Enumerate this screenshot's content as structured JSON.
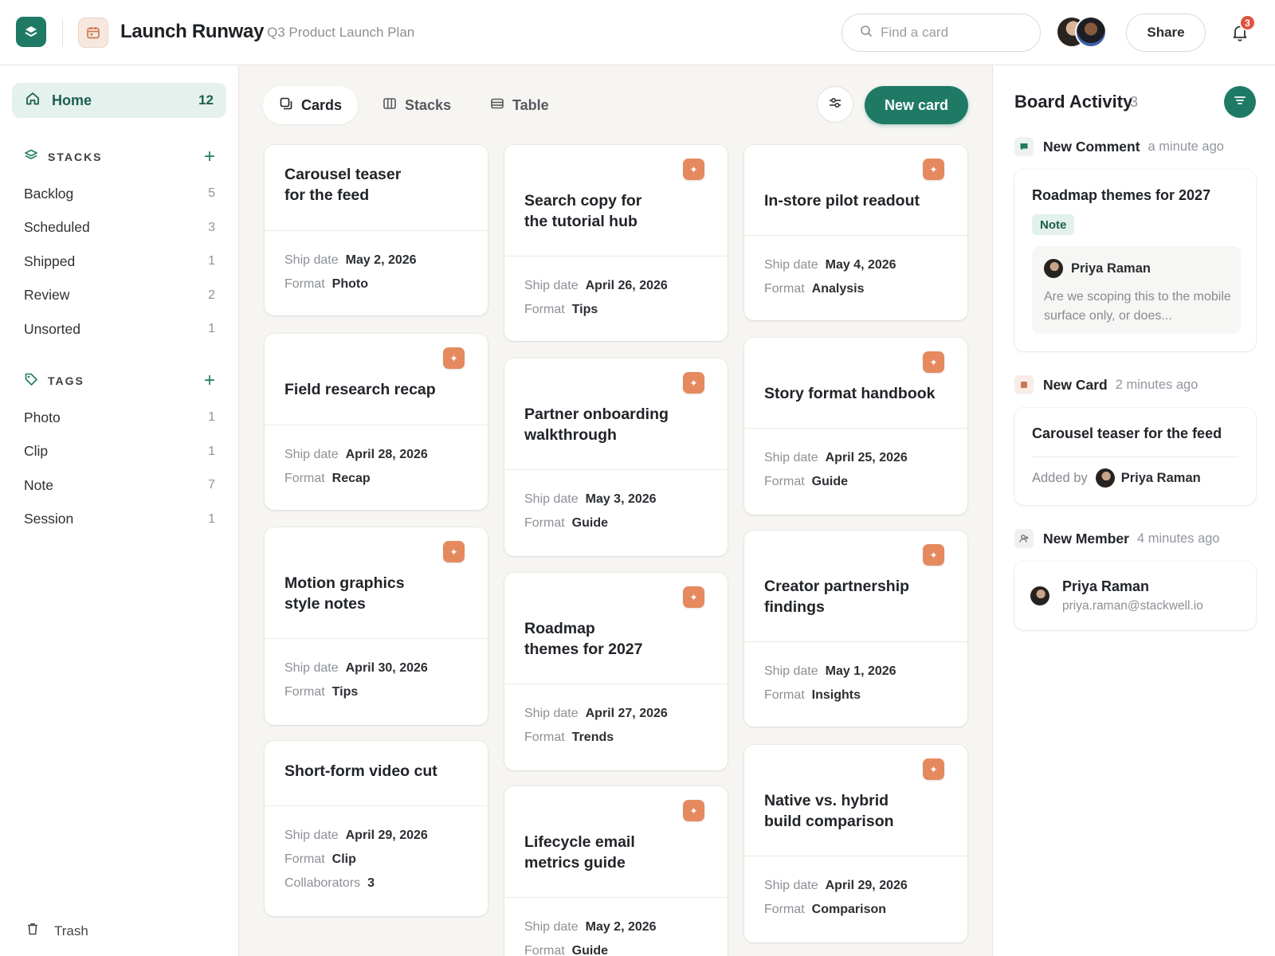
{
  "header": {
    "board_title": "Launch Runway",
    "board_subtitle": "Q3 Product Launch Plan",
    "search_placeholder": "Find a card",
    "share_label": "Share",
    "notification_count": "3"
  },
  "sidebar": {
    "home": {
      "label": "Home",
      "count": "12"
    },
    "stacks_title": "STACKS",
    "stacks": [
      {
        "label": "Backlog",
        "count": "5"
      },
      {
        "label": "Scheduled",
        "count": "3"
      },
      {
        "label": "Shipped",
        "count": "1"
      },
      {
        "label": "Review",
        "count": "2"
      },
      {
        "label": "Unsorted",
        "count": "1"
      }
    ],
    "tags_title": "TAGS",
    "tags": [
      {
        "label": "Photo",
        "count": "1"
      },
      {
        "label": "Clip",
        "count": "1"
      },
      {
        "label": "Note",
        "count": "7"
      },
      {
        "label": "Session",
        "count": "1"
      }
    ],
    "trash_label": "Trash"
  },
  "main": {
    "tabs": [
      {
        "label": "Cards",
        "active": true
      },
      {
        "label": "Stacks",
        "active": false
      },
      {
        "label": "Table",
        "active": false
      }
    ],
    "new_card_label": "New card",
    "meta_labels": {
      "ship_date": "Ship date",
      "format": "Format",
      "collaborators": "Collaborators"
    },
    "cards": [
      {
        "title_line1": "Carousel teaser",
        "title_line2": "for the feed",
        "ship_date": "May 2, 2026",
        "format": "Photo",
        "badge": false
      },
      {
        "title_line1": "Field research recap",
        "title_line2": "",
        "ship_date": "April 28, 2026",
        "format": "Recap",
        "badge": true
      },
      {
        "title_line1": "Motion graphics",
        "title_line2": "style notes",
        "ship_date": "April 30, 2026",
        "format": "Tips",
        "badge": true
      },
      {
        "title_line1": "Short-form video cut",
        "title_line2": "",
        "ship_date": "April 29, 2026",
        "format": "Clip",
        "collaborators": "3",
        "badge": false
      },
      {
        "title_line1": "Search copy for",
        "title_line2": "the tutorial hub",
        "ship_date": "April 26, 2026",
        "format": "Tips",
        "badge": true
      },
      {
        "title_line1": "Partner onboarding",
        "title_line2": "walkthrough",
        "ship_date": "May 3, 2026",
        "format": "Guide",
        "badge": true
      },
      {
        "title_line1": "Roadmap",
        "title_line2": "themes for 2027",
        "ship_date": "April 27, 2026",
        "format": "Trends",
        "badge": true
      },
      {
        "title_line1": "Lifecycle email",
        "title_line2": "metrics guide",
        "ship_date": "May 2, 2026",
        "format": "Guide",
        "badge": true
      },
      {
        "title_line1": "In-store pilot readout",
        "title_line2": "",
        "ship_date": "May 4, 2026",
        "format": "Analysis",
        "badge": true
      },
      {
        "title_line1": "Story format handbook",
        "title_line2": "",
        "ship_date": "April 25, 2026",
        "format": "Guide",
        "badge": true
      },
      {
        "title_line1": "Creator partnership",
        "title_line2": "findings",
        "ship_date": "May 1, 2026",
        "format": "Insights",
        "badge": true
      },
      {
        "title_line1": "Native vs. hybrid",
        "title_line2": "build comparison",
        "ship_date": "April 29, 2026",
        "format": "Comparison",
        "badge": true
      }
    ]
  },
  "activity": {
    "title": "Board Activity",
    "count": "3",
    "events": [
      {
        "type": "New Comment",
        "time": "a minute ago",
        "card_title": "Roadmap themes for 2027",
        "tag": "Note",
        "author": "Priya Raman",
        "comment": "Are we scoping this to the mobile surface only, or does..."
      },
      {
        "type": "New Card",
        "time": "2 minutes ago",
        "card_title": "Carousel teaser for the feed",
        "added_by_label": "Added by",
        "author": "Priya Raman"
      },
      {
        "type": "New Member",
        "time": "4 minutes ago",
        "member_name": "Priya Raman",
        "member_email": "priya.raman@stackwell.io"
      }
    ]
  },
  "colors": {
    "accent": "#1f7a65",
    "accent_soft": "#e4f1ec",
    "badge_orange": "#e58a5f",
    "notification_red": "#e0533f"
  },
  "icons": [
    "app-logo-icon",
    "calendar-icon",
    "search-icon",
    "bell-icon",
    "home-icon",
    "layers-icon",
    "tag-icon",
    "plus-icon",
    "trash-icon",
    "cards-icon",
    "columns-icon",
    "table-icon",
    "sliders-icon",
    "sparkle-icon",
    "comment-icon",
    "card-icon",
    "user-icon",
    "filter-lines-icon"
  ]
}
